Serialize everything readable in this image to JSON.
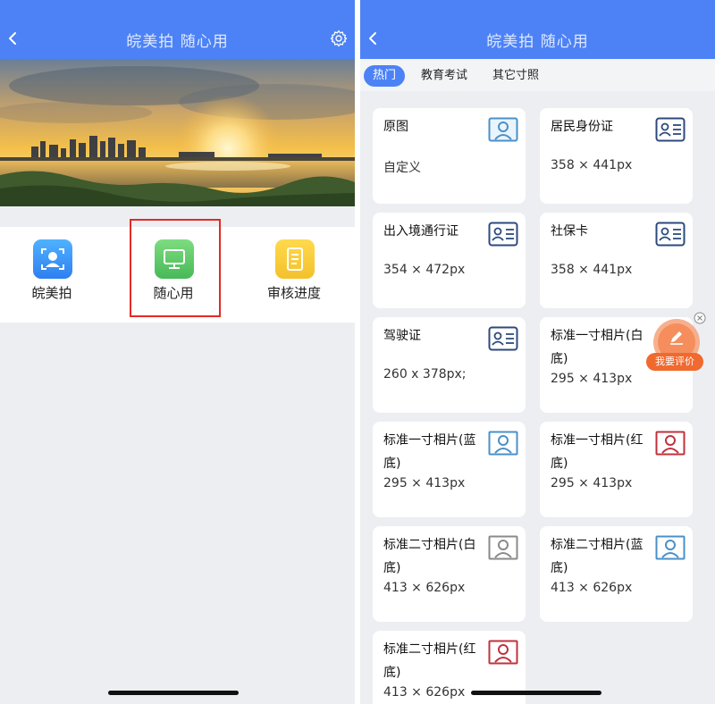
{
  "left_screen": {
    "title": "皖美拍 随心用",
    "functions": [
      {
        "label": "皖美拍",
        "icon": "face-scan-icon",
        "color": "#3a9af6"
      },
      {
        "label": "随心用",
        "icon": "monitor-icon",
        "color": "#5cc765"
      },
      {
        "label": "审核进度",
        "icon": "document-icon",
        "color": "#f6c93a"
      }
    ]
  },
  "right_screen": {
    "title": "皖美拍 随心用",
    "tabs": [
      {
        "label": "热门",
        "active": true
      },
      {
        "label": "教育考试",
        "active": false
      },
      {
        "label": "其它寸照",
        "active": false
      }
    ],
    "cards": [
      {
        "title": "原图",
        "sub": "自定义",
        "icon": "portrait-icon"
      },
      {
        "title": "居民身份证",
        "sub": "358 × 441px",
        "icon": "id-card-icon"
      },
      {
        "title": "出入境通行证",
        "sub": "354 × 472px",
        "icon": "id-card-icon"
      },
      {
        "title": "社保卡",
        "sub": "358 × 441px",
        "icon": "id-card-icon"
      },
      {
        "title": "驾驶证",
        "sub": "260 x 378px;",
        "icon": "id-card-icon"
      },
      {
        "title": "标准一寸相片(白底)",
        "sub": "295 × 413px",
        "icon": "photo-white-icon"
      },
      {
        "title": "标准一寸相片(蓝底)",
        "sub": "295 × 413px",
        "icon": "photo-blue-icon"
      },
      {
        "title": "标准一寸相片(红底)",
        "sub": "295 × 413px",
        "icon": "photo-red-icon"
      },
      {
        "title": "标准二寸相片(白底)",
        "sub": "413 × 626px",
        "icon": "photo-white-icon"
      },
      {
        "title": "标准二寸相片(蓝底)",
        "sub": "413 × 626px",
        "icon": "photo-blue-icon"
      },
      {
        "title": "标准二寸相片(红底)",
        "sub": "413 × 626px",
        "icon": "photo-red-icon"
      }
    ],
    "feedback_label": "我要评价"
  },
  "colors": {
    "header_blue": "#4c82f6",
    "highlight_red": "#e22b24",
    "id_icon_navy": "#2c4a7e",
    "photo_blue": "#4a90c8",
    "photo_red": "#c0323c",
    "photo_gray": "#8a8a8a",
    "feedback_orange": "#f0692e"
  }
}
